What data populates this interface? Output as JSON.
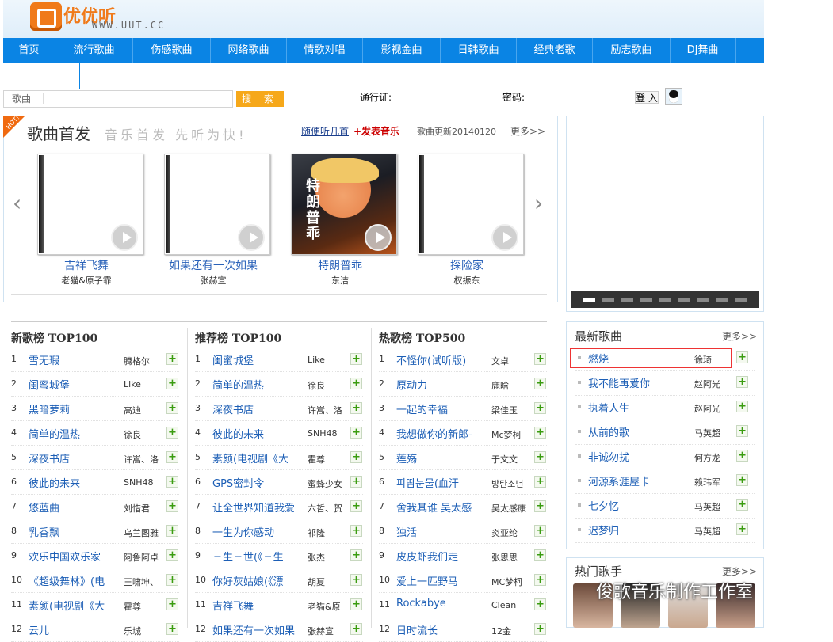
{
  "header": {
    "logo_text": "优优听",
    "logo_url": "WWW.UUT.CC"
  },
  "nav": {
    "items": [
      "首页",
      "流行歌曲",
      "伤感歌曲",
      "网络歌曲",
      "情歌对唱",
      "影视金曲",
      "日韩歌曲",
      "经典老歌",
      "励志歌曲",
      "DJ舞曲"
    ]
  },
  "search": {
    "category": "歌曲",
    "button": "搜 索"
  },
  "login": {
    "pass_label": "通行证:",
    "pwd_label": "密码:",
    "button": "登 入"
  },
  "new_songs": {
    "hot_tag": "HOT!",
    "title": "歌曲首发",
    "slogan": "音乐首发 先听为快!",
    "random_link": "随便听几首",
    "publish_link": "+发表音乐",
    "update": "歌曲更新20140120",
    "more": "更多>>",
    "albums": [
      {
        "name": "吉祥飞舞",
        "artist": "老猫&原子霏"
      },
      {
        "name": "如果还有一次如果",
        "artist": "张赫宣"
      },
      {
        "name": "特朗普乖",
        "artist": "东洁",
        "cover_text": "特朗普乖"
      },
      {
        "name": "探险家",
        "artist": "权振东"
      }
    ]
  },
  "charts": [
    {
      "title": "新歌榜 TOP100",
      "rows": [
        {
          "n": "1",
          "t": "雪无瑕",
          "a": "腾格尔"
        },
        {
          "n": "2",
          "t": "闺蜜城堡",
          "a": "Like"
        },
        {
          "n": "3",
          "t": "黑暗萝莉",
          "a": "高迪"
        },
        {
          "n": "4",
          "t": "简单的温热",
          "a": "徐良"
        },
        {
          "n": "5",
          "t": "深夜书店",
          "a": "许嵩、洛"
        },
        {
          "n": "6",
          "t": "彼此的未来",
          "a": "SNH48"
        },
        {
          "n": "7",
          "t": "悠蓝曲",
          "a": "刘惜君"
        },
        {
          "n": "8",
          "t": "乳香飘",
          "a": "乌兰图雅"
        },
        {
          "n": "9",
          "t": "欢乐中国欢乐家",
          "a": "阿鲁阿卓"
        },
        {
          "n": "10",
          "t": "《超级舞林》(电",
          "a": "王啸坤、"
        },
        {
          "n": "11",
          "t": "素颜(电视剧《大",
          "a": "霍尊"
        },
        {
          "n": "12",
          "t": "云儿",
          "a": "乐城"
        }
      ]
    },
    {
      "title": "推荐榜 TOP100",
      "rows": [
        {
          "n": "1",
          "t": "闺蜜城堡",
          "a": "Like"
        },
        {
          "n": "2",
          "t": "简单的温热",
          "a": "徐良"
        },
        {
          "n": "3",
          "t": "深夜书店",
          "a": "许嵩、洛"
        },
        {
          "n": "4",
          "t": "彼此的未来",
          "a": "SNH48"
        },
        {
          "n": "5",
          "t": "素颜(电视剧《大",
          "a": "霍尊"
        },
        {
          "n": "6",
          "t": "GPS密封令",
          "a": "蜜蜂少女"
        },
        {
          "n": "7",
          "t": "让全世界知道我爱",
          "a": "六哲、贺"
        },
        {
          "n": "8",
          "t": "一生为你感动",
          "a": "祁隆"
        },
        {
          "n": "9",
          "t": "三生三世(《三生",
          "a": "张杰"
        },
        {
          "n": "10",
          "t": "你好灰姑娘(《漂",
          "a": "胡夏"
        },
        {
          "n": "11",
          "t": "吉祥飞舞",
          "a": "老猫&原"
        },
        {
          "n": "12",
          "t": "如果还有一次如果",
          "a": "张赫宣"
        }
      ]
    },
    {
      "title": "热歌榜 TOP500",
      "rows": [
        {
          "n": "1",
          "t": "不怪你(试听版)",
          "a": "文卓"
        },
        {
          "n": "2",
          "t": "原动力",
          "a": "鹿晗"
        },
        {
          "n": "3",
          "t": "一起的幸福",
          "a": "梁佳玉"
        },
        {
          "n": "4",
          "t": "我想做你的新郎-",
          "a": "Mc梦柯"
        },
        {
          "n": "5",
          "t": "莲殇",
          "a": "于文文"
        },
        {
          "n": "6",
          "t": "피땀눈물(血汗",
          "a": "방탄소년"
        },
        {
          "n": "7",
          "t": "舍我其谁 吴太感",
          "a": "吴太感康"
        },
        {
          "n": "8",
          "t": "独活",
          "a": "炎亚纶"
        },
        {
          "n": "9",
          "t": "皮皮虾我们走",
          "a": "张思思"
        },
        {
          "n": "10",
          "t": "爱上一匹野马",
          "a": "MC梦柯"
        },
        {
          "n": "11",
          "t": "Rockabye",
          "a": "Clean"
        },
        {
          "n": "12",
          "t": "日时流长",
          "a": "12金"
        }
      ]
    }
  ],
  "latest": {
    "title": "最新歌曲",
    "more": "更多>>",
    "rows": [
      {
        "t": "燃烧",
        "a": "徐琦"
      },
      {
        "t": "我不能再爱你",
        "a": "赵阿光"
      },
      {
        "t": "执着人生",
        "a": "赵阿光"
      },
      {
        "t": "从前的歌",
        "a": "马英超"
      },
      {
        "t": "非诚勿扰",
        "a": "何方龙"
      },
      {
        "t": "河源系涯屋卡",
        "a": "赖玮军"
      },
      {
        "t": "七夕忆",
        "a": "马英超"
      },
      {
        "t": "迟梦归",
        "a": "马英超"
      }
    ]
  },
  "singers": {
    "title": "热门歌手",
    "more": "更多>>"
  },
  "watermark": "俊歌音乐制作工作室",
  "colors": {
    "nav": "#0a84e4",
    "accent": "#f6a81a",
    "link": "#1d5fb6",
    "highlight": "#e33333"
  }
}
